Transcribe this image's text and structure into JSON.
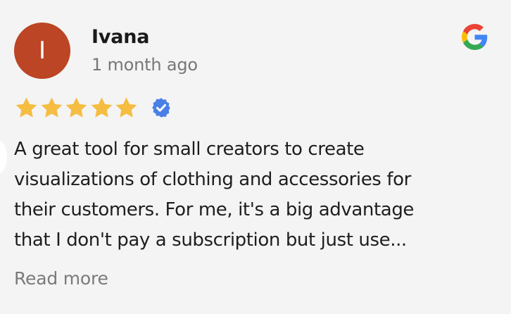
{
  "review": {
    "avatar_initial": "I",
    "reviewer_name": "Ivana",
    "time_ago": "1 month ago",
    "rating": 5,
    "rating_max": 5,
    "verified": true,
    "text_lines": [
      "A great tool for small creators to create",
      "visualizations of clothing and accessories for",
      "their customers. For me, it's a big advantage",
      "that I don't pay a subscription but just use..."
    ],
    "read_more_label": "Read more"
  },
  "source_icon": "google-g-icon",
  "colors": {
    "background": "#f4f4f4",
    "avatar": "#bb4524",
    "star": "#f5bd41",
    "verified_badge": "#4a80e6",
    "google_blue": "#4285F4",
    "google_red": "#EA4335",
    "google_yellow": "#FBBC05",
    "google_green": "#34A853",
    "muted_text": "#777777"
  }
}
